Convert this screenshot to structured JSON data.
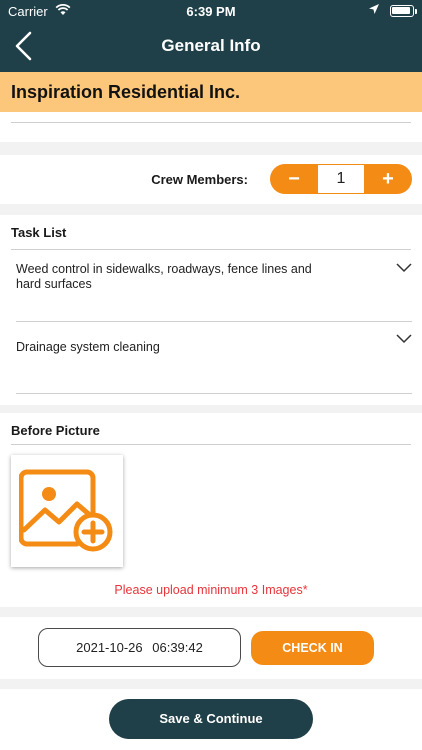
{
  "status_bar": {
    "carrier": "Carrier",
    "time": "6:39 PM"
  },
  "header": {
    "title": "General Info",
    "back_icon": "chevron-left-icon"
  },
  "company": {
    "name": "Inspiration Residential Inc."
  },
  "crew": {
    "label": "Crew Members:",
    "value": "1",
    "minus_label": "−",
    "plus_label": "+"
  },
  "task_list": {
    "title": "Task List",
    "items": [
      {
        "label": "Weed control in sidewalks, roadways, fence lines and hard surfaces"
      },
      {
        "label": "Drainage system cleaning"
      }
    ]
  },
  "before_picture": {
    "title": "Before Picture",
    "upload_icon": "add-image-icon",
    "warning": "Please upload minimum 3 Images*"
  },
  "checkin": {
    "datetime": "2021-10-26 06:39:42",
    "button_label": "CHECK IN"
  },
  "footer": {
    "save_label": "Save & Continue"
  },
  "colors": {
    "primary": "#1f4048",
    "accent": "#f48b15",
    "banner": "#fdc77b",
    "warning": "#e8343c"
  }
}
